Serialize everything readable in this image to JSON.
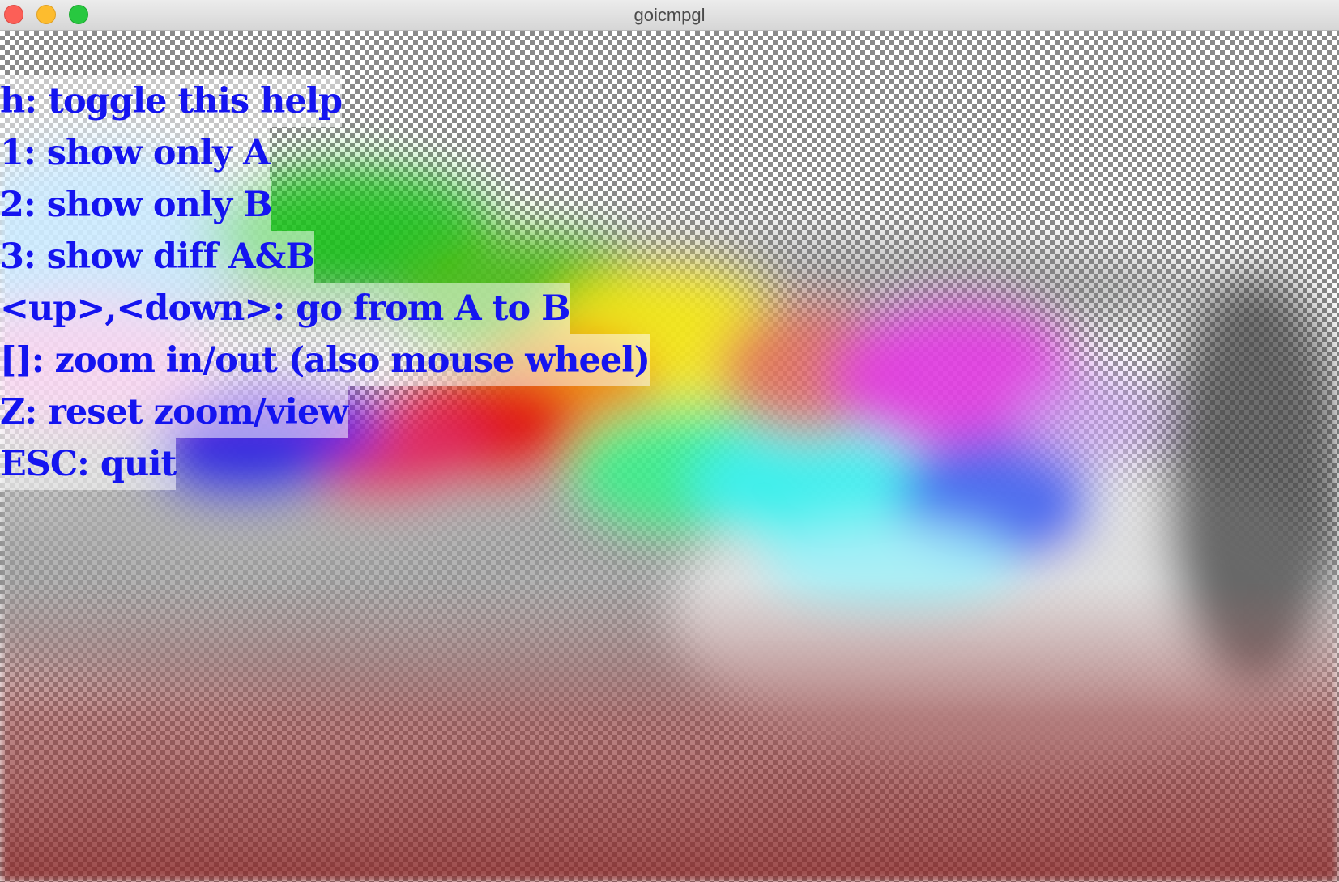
{
  "window": {
    "title": "goicmpgl",
    "controls": [
      "close-icon",
      "minimize-icon",
      "zoom-icon"
    ]
  },
  "help": {
    "lines": [
      "h: toggle this help",
      "1: show only A",
      "2: show only B",
      "3: show diff A&B",
      "<up>,<down>: go from A to B",
      "[]: zoom in/out (also mouse wheel)",
      "Z: reset zoom/view",
      "ESC: quit"
    ],
    "text_color": "#1414f0"
  },
  "colors": {
    "checker_dark": "#8a8a8a",
    "checker_light": "#ffffff"
  }
}
